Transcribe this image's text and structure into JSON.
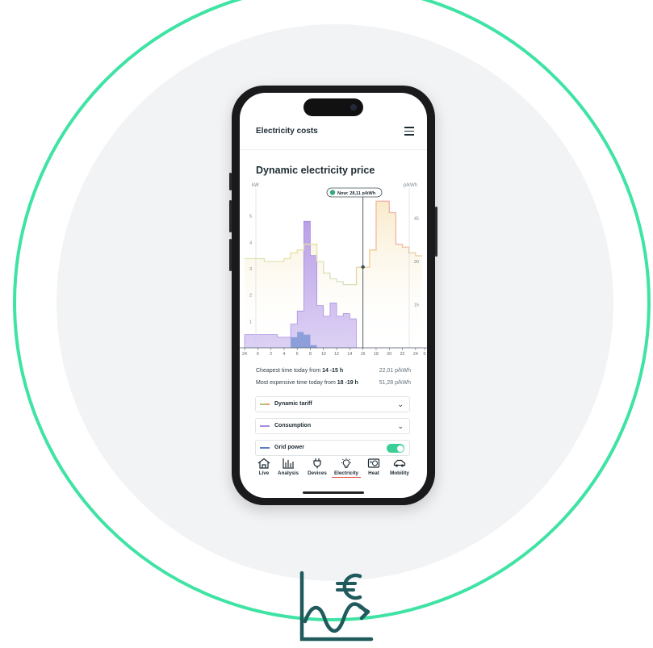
{
  "app": {
    "title": "Electricity costs",
    "page_title": "Dynamic electricity price"
  },
  "chart": {
    "left_unit": "kW",
    "right_unit": "p/kWh",
    "tooltip": "Now: 28,11 p/kWh",
    "left_ticks": [
      "5",
      "4",
      "3",
      "2",
      "1"
    ],
    "right_ticks": [
      "45",
      "30",
      "15"
    ],
    "x_ticks": [
      "24",
      "0",
      "2",
      "4",
      "6",
      "8",
      "10",
      "12",
      "14",
      "16",
      "18",
      "20",
      "22",
      "24",
      "0"
    ]
  },
  "chart_data": {
    "type": "area",
    "x_hours": [
      -2,
      -1,
      0,
      1,
      2,
      3,
      4,
      5,
      6,
      7,
      8,
      9,
      10,
      11,
      12,
      13,
      14,
      15,
      16,
      17,
      18,
      19,
      20,
      21,
      22,
      23,
      24
    ],
    "price_p_per_kwh": [
      31,
      31,
      31,
      30,
      30,
      30,
      31,
      33,
      34,
      36,
      36,
      30,
      26,
      24,
      23,
      22,
      22,
      28,
      28,
      34,
      51,
      51,
      47,
      36,
      35,
      33,
      32
    ],
    "consumption_kw": [
      0.5,
      0.5,
      0.5,
      0.5,
      0.5,
      0.4,
      0.4,
      0.9,
      1.4,
      4.8,
      3.5,
      1.6,
      1.2,
      1.7,
      1.2,
      1.3,
      1.1,
      0,
      0,
      0,
      0,
      0,
      0,
      0,
      0,
      0,
      0
    ],
    "grid_power_kw": [
      0,
      0,
      0,
      0,
      0,
      0,
      0,
      0.4,
      0.6,
      0.5,
      0.1,
      0,
      0,
      0,
      0,
      0,
      0,
      0,
      0,
      0,
      0,
      0,
      0,
      0,
      0,
      0,
      0
    ],
    "now_hour": 16,
    "now_price": 28.11,
    "y_left_range": [
      0,
      6
    ],
    "y_right_range": [
      0,
      55
    ]
  },
  "info": {
    "cheapest_prefix": "Cheapest time today from ",
    "cheapest_time": "14 -15 h",
    "cheapest_price": "22,01 p/kWh",
    "expensive_prefix": "Most expensive time today from ",
    "expensive_time": "18 -19 h",
    "expensive_price": "51,28 p/kWh"
  },
  "legend": [
    {
      "label": "Dynamic tariff",
      "control": "chevron-down",
      "color": "#e8a84e"
    },
    {
      "label": "Consumption",
      "control": "chevron-down",
      "color": "#a88ae0"
    },
    {
      "label": "Grid power",
      "control": "toggle",
      "toggle_on": true,
      "color": "#5a7ec8"
    }
  ],
  "nav": [
    {
      "label": "Live",
      "icon": "house-icon"
    },
    {
      "label": "Analysis",
      "icon": "bar-chart-icon"
    },
    {
      "label": "Devices",
      "icon": "plug-icon"
    },
    {
      "label": "Electricity",
      "icon": "bulb-icon",
      "active": true
    },
    {
      "label": "Heat",
      "icon": "heat-pump-icon"
    },
    {
      "label": "Mobility",
      "icon": "car-icon"
    }
  ],
  "colors": {
    "accent": "#3fe3a4",
    "logo": "#1f5a5c",
    "active_underline": "#e2463a",
    "toggle": "#3ccf95"
  }
}
